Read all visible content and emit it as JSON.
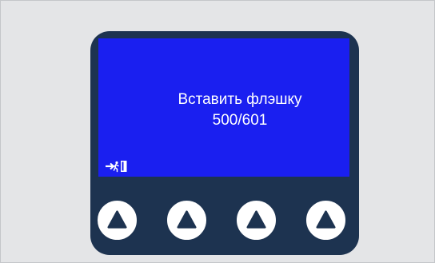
{
  "screen": {
    "line1": "Вставить флэшку",
    "line2": "500/601",
    "exit_icon": "exit-icon"
  },
  "buttons": [
    {
      "icon": "triangle-up-icon"
    },
    {
      "icon": "triangle-up-icon"
    },
    {
      "icon": "triangle-up-icon"
    },
    {
      "icon": "triangle-up-icon"
    }
  ],
  "colors": {
    "background": "#e4e5e7",
    "device_body": "#1d3350",
    "screen": "#1a1ff0",
    "screen_text": "#ffffff",
    "button": "#ffffff"
  }
}
